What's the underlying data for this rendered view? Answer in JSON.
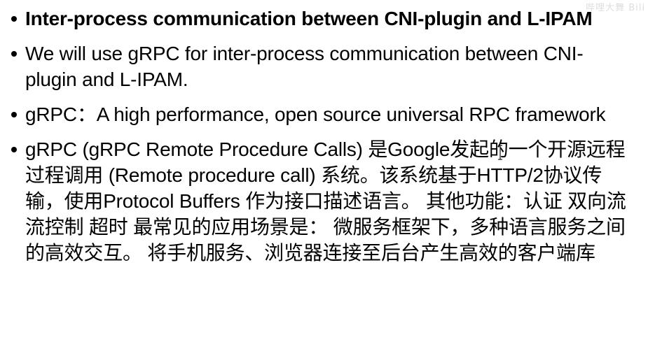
{
  "watermark": "哔哩大舞 Bili",
  "bullets": [
    {
      "text": "Inter-process communication between CNI-plugin and L-IPAM",
      "bold": true
    },
    {
      "text": "We will use gRPC for inter-process communication between CNI-plugin and L-IPAM.",
      "bold": false
    },
    {
      "text": "gRPC：A high performance, open source universal RPC framework",
      "bold": false
    },
    {
      "text": "gRPC (gRPC Remote Procedure Calls) 是Google发起的一个开源远程过程调用 (Remote procedure call) 系统。该系统基于HTTP/2协议传输，使用Protocol Buffers 作为接口描述语言。 其他功能：认证 双向流 流控制 超时 最常见的应用场景是： 微服务框架下，多种语言服务之间的高效交互。 将手机服务、浏览器连接至后台产生高效的客户端库",
      "bold": false
    }
  ],
  "cursor_icon": "text-cursor-icon"
}
